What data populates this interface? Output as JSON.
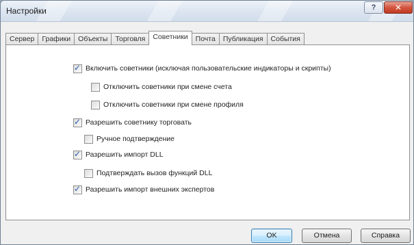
{
  "window": {
    "title": "Настройки",
    "help_glyph": "?",
    "close_glyph": "✕"
  },
  "tabs": [
    {
      "label": "Сервер",
      "active": false
    },
    {
      "label": "Графики",
      "active": false
    },
    {
      "label": "Объекты",
      "active": false
    },
    {
      "label": "Торговля",
      "active": false
    },
    {
      "label": "Советники",
      "active": true
    },
    {
      "label": "Почта",
      "active": false
    },
    {
      "label": "Публикация",
      "active": false
    },
    {
      "label": "События",
      "active": false
    }
  ],
  "options": [
    {
      "label": "Включить советники (исключая пользовательские индикаторы и скрипты)",
      "checked": true
    },
    {
      "label": "Отключить советники при смене счета",
      "checked": false
    },
    {
      "label": "Отключить советники при смене профиля",
      "checked": false
    },
    {
      "label": "Разрешить советнику торговать",
      "checked": true
    },
    {
      "label": "Ручное подтверждение",
      "checked": false
    },
    {
      "label": "Разрешить импорт DLL",
      "checked": true
    },
    {
      "label": "Подтверждать вызов функций DLL",
      "checked": false
    },
    {
      "label": "Разрешить импорт внешних экспертов",
      "checked": true
    }
  ],
  "buttons": {
    "ok": "OK",
    "cancel": "Отмена",
    "help": "Справка"
  },
  "colors": {
    "accent": "#2a5fa8",
    "close_button": "#c23a22"
  }
}
